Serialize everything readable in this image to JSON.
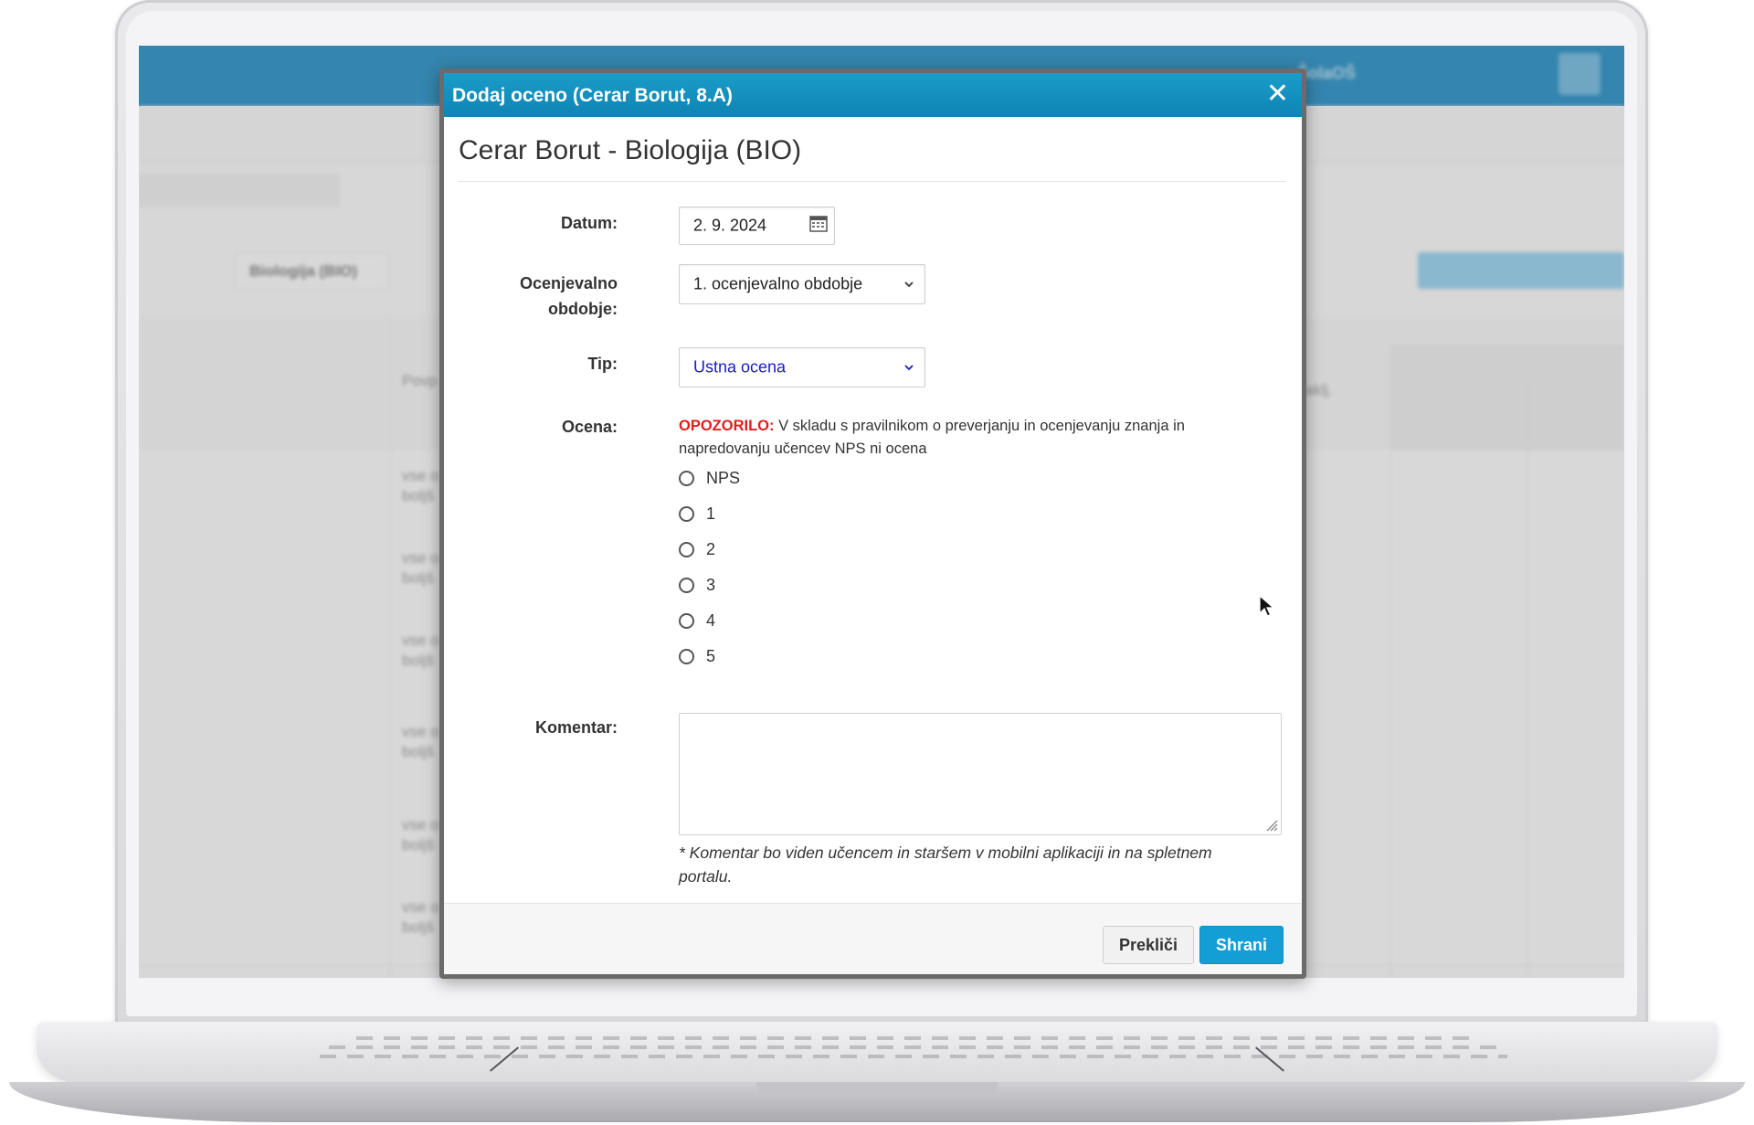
{
  "background_app": {
    "header_school": "ŠolaOŠ",
    "filter_subject": "Biologija (BIO)",
    "column_povp": "Povp",
    "column_zaklj": "Zaklj.",
    "row_text_1": "vse o",
    "row_text_2": "boljš"
  },
  "modal": {
    "title": "Dodaj oceno (Cerar Borut, 8.A)",
    "close_symbol": "✕",
    "heading": "Cerar Borut - Biologija (BIO)",
    "date": {
      "label": "Datum:",
      "value": "2. 9. 2024"
    },
    "period": {
      "label_line1": "Ocenjevalno",
      "label_line2": "obdobje:",
      "value": "1. ocenjevalno obdobje"
    },
    "type": {
      "label": "Tip:",
      "value": "Ustna ocena"
    },
    "grade": {
      "label": "Ocena:",
      "warning_prefix": "OPOZORILO:",
      "warning_text": " V skladu s pravilnikom o preverjanju in ocenjevanju znanja in napredovanju učencev NPS ni ocena",
      "options": [
        "NPS",
        "1",
        "2",
        "3",
        "4",
        "5"
      ]
    },
    "comment": {
      "label": "Komentar:",
      "value": "",
      "note": "* Komentar bo viden učencem in staršem v mobilni aplikaciji in na spletnem portalu."
    },
    "buttons": {
      "cancel": "Prekliči",
      "save": "Shrani"
    }
  },
  "colors": {
    "header": "#1a9cc9",
    "save_button": "#139ed6",
    "warning": "#e01e1e",
    "select_type_text": "#1a1acc"
  }
}
